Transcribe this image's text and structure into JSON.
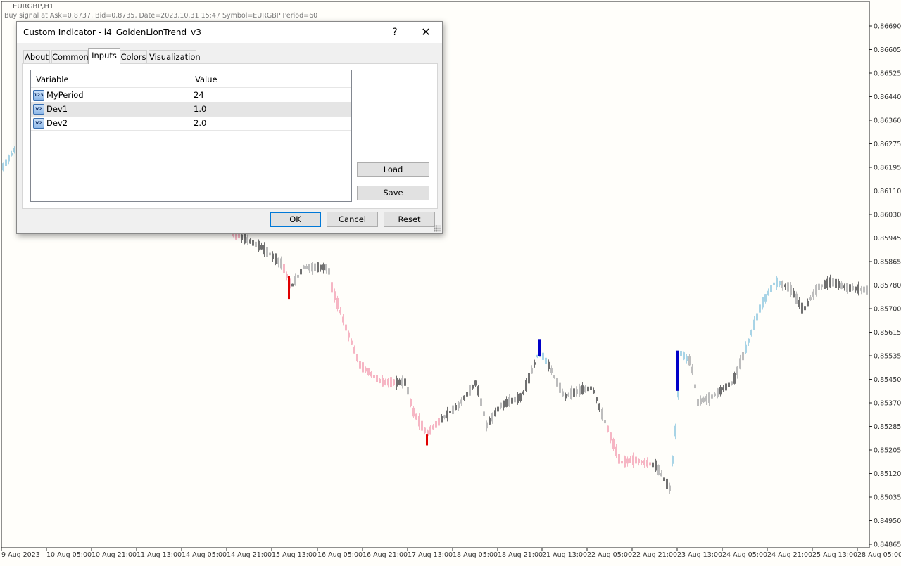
{
  "chart": {
    "symbol_timeframe": "EURGBP,H1",
    "signal_text": "Buy signal at Ask=0.8737, Bid=0.8735, Date=2023.10.31 15:47 Symbol=EURGBP Period=60",
    "price_ticks": [
      "0.86690",
      "0.86605",
      "0.86525",
      "0.86440",
      "0.86360",
      "0.86275",
      "0.86195",
      "0.86110",
      "0.86030",
      "0.85945",
      "0.85865",
      "0.85780",
      "0.85700",
      "0.85615",
      "0.85535",
      "0.85450",
      "0.85370",
      "0.85285",
      "0.85205",
      "0.85120",
      "0.85035",
      "0.84950",
      "0.84865"
    ],
    "time_ticks": [
      "9 Aug 2023",
      "10 Aug 05:00",
      "10 Aug 21:00",
      "11 Aug 13:00",
      "14 Aug 05:00",
      "14 Aug 21:00",
      "15 Aug 13:00",
      "16 Aug 05:00",
      "16 Aug 21:00",
      "17 Aug 13:00",
      "18 Aug 05:00",
      "18 Aug 21:00",
      "21 Aug 13:00",
      "22 Aug 05:00",
      "22 Aug 21:00",
      "23 Aug 13:00",
      "24 Aug 05:00",
      "24 Aug 21:00",
      "25 Aug 13:00",
      "28 Aug 05:00"
    ],
    "colors": {
      "background": "#fffefa",
      "uptrend": "#a8d4e6",
      "downtrend": "#f6b6c4",
      "neutral_up": "#bdbdbd",
      "neutral_down": "#707070",
      "buy_signal": "#0000c8",
      "sell_signal": "#e00000"
    }
  },
  "dialog": {
    "title": "Custom Indicator - i4_GoldenLionTrend_v3",
    "help_label": "?",
    "close_label": "✕",
    "tabs": [
      "About",
      "Common",
      "Inputs",
      "Colors",
      "Visualization"
    ],
    "active_tab": "Inputs",
    "grid": {
      "headers": [
        "Variable",
        "Value"
      ],
      "rows": [
        {
          "name": "MyPeriod",
          "value": "24",
          "icon": "123"
        },
        {
          "name": "Dev1",
          "value": "1.0",
          "icon": "V2"
        },
        {
          "name": "Dev2",
          "value": "2.0",
          "icon": "V2"
        }
      ],
      "selected_row": 1
    },
    "buttons": {
      "load": "Load",
      "save": "Save",
      "ok": "OK",
      "cancel": "Cancel",
      "reset": "Reset"
    }
  }
}
